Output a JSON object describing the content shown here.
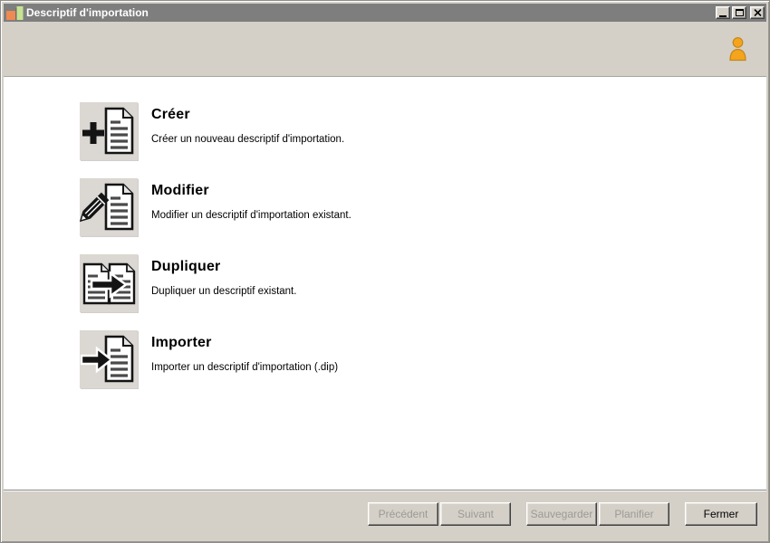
{
  "window": {
    "title": "Descriptif d'importation",
    "controls": {
      "minimize": "minimize",
      "maximize": "maximize",
      "close": "close"
    }
  },
  "header": {
    "user_icon": "person-icon",
    "accent_color": "#f4a41d"
  },
  "options": [
    {
      "id": "creer",
      "icon": "plus-document-icon",
      "title": "Créer",
      "description": "Créer un nouveau descriptif d'importation."
    },
    {
      "id": "modifier",
      "icon": "pencil-document-icon",
      "title": "Modifier",
      "description": "Modifier un descriptif d'importation existant."
    },
    {
      "id": "dupliquer",
      "icon": "duplicate-document-icon",
      "title": "Dupliquer",
      "description": "Dupliquer un descriptif existant."
    },
    {
      "id": "importer",
      "icon": "import-arrow-document-icon",
      "title": "Importer",
      "description": "Importer un descriptif d'importation (.dip)"
    }
  ],
  "footer": {
    "buttons": [
      {
        "label": "Précédent",
        "enabled": false
      },
      {
        "label": "Suivant",
        "enabled": false
      },
      {
        "label": "Sauvegarder",
        "enabled": false
      },
      {
        "label": "Planifier",
        "enabled": false
      },
      {
        "label": "Fermer",
        "enabled": true
      }
    ]
  },
  "colors": {
    "titlebar": "#7e7e7e",
    "chrome": "#d4d0c8",
    "content_bg": "#ffffff",
    "icon_tile_bg": "#dbd7d2",
    "disabled_text": "#9c9a96",
    "logo_orange": "#ee8a52",
    "logo_green": "#c6e393",
    "person_orange": "#f4a41d"
  }
}
